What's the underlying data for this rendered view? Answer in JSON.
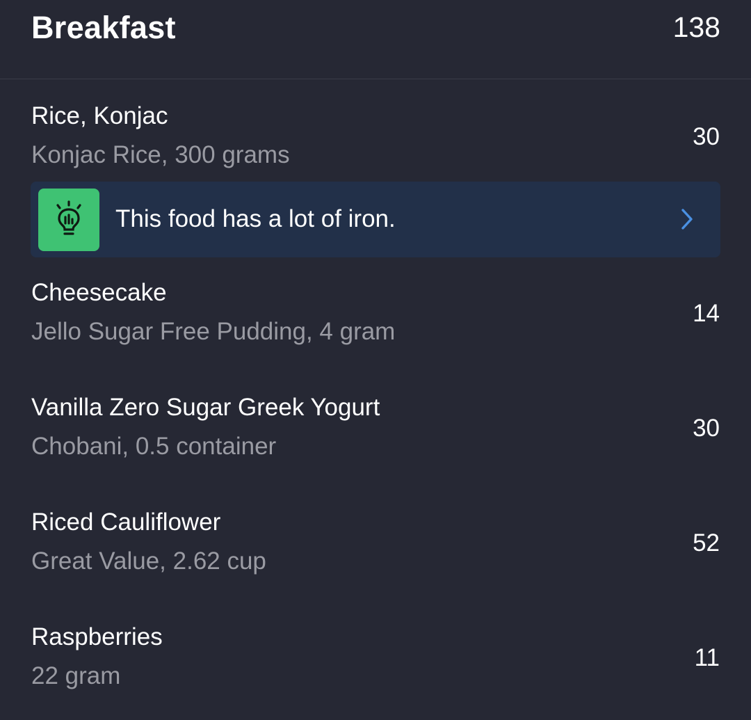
{
  "meal": {
    "title": "Breakfast",
    "total_calories": "138"
  },
  "entries": [
    {
      "name": "Rice, Konjac",
      "detail": "Konjac Rice, 300 grams",
      "calories": "30"
    },
    {
      "name": "Cheesecake",
      "detail": "Jello Sugar Free Pudding, 4 gram",
      "calories": "14"
    },
    {
      "name": "Vanilla Zero Sugar Greek Yogurt",
      "detail": "Chobani, 0.5 container",
      "calories": "30"
    },
    {
      "name": "Riced Cauliflower",
      "detail": "Great Value, 2.62 cup",
      "calories": "52"
    },
    {
      "name": "Raspberries",
      "detail": "22 gram",
      "calories": "11"
    }
  ],
  "insight": {
    "text": "This food has a lot of iron.",
    "icon": "lightbulb-icon",
    "action_icon": "chevron-right-icon",
    "icon_bg_color": "#3fc273",
    "accent_color": "#4a90e2",
    "banner_color": "#223049"
  },
  "colors": {
    "background": "#262834",
    "primary_text": "#ffffff",
    "secondary_text": "#9a9ba3"
  }
}
